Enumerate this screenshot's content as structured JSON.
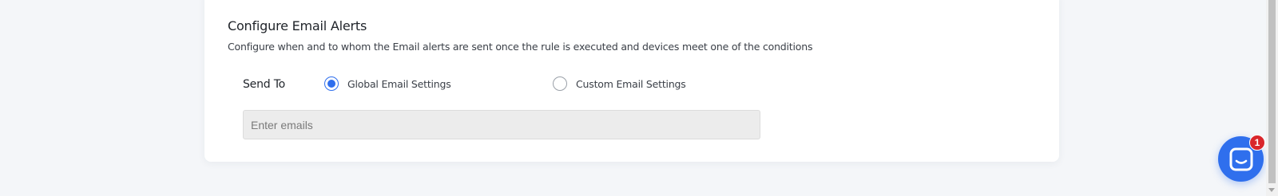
{
  "email_alerts": {
    "title": "Configure Email Alerts",
    "description": "Configure when and to whom the Email alerts are sent once the rule is executed and devices meet one of the conditions",
    "send_to_label": "Send To",
    "options": [
      {
        "label": "Global Email Settings",
        "selected": true
      },
      {
        "label": "Custom Email Settings",
        "selected": false
      }
    ],
    "emails_input": {
      "value": "",
      "placeholder": "Enter emails"
    }
  },
  "chat": {
    "icon": "chat-bubble-icon",
    "unread_count": "1"
  },
  "colors": {
    "accent": "#2f6fed",
    "badge": "#d9262c",
    "input_background": "#ececec",
    "page_background": "#f4f6f9"
  }
}
